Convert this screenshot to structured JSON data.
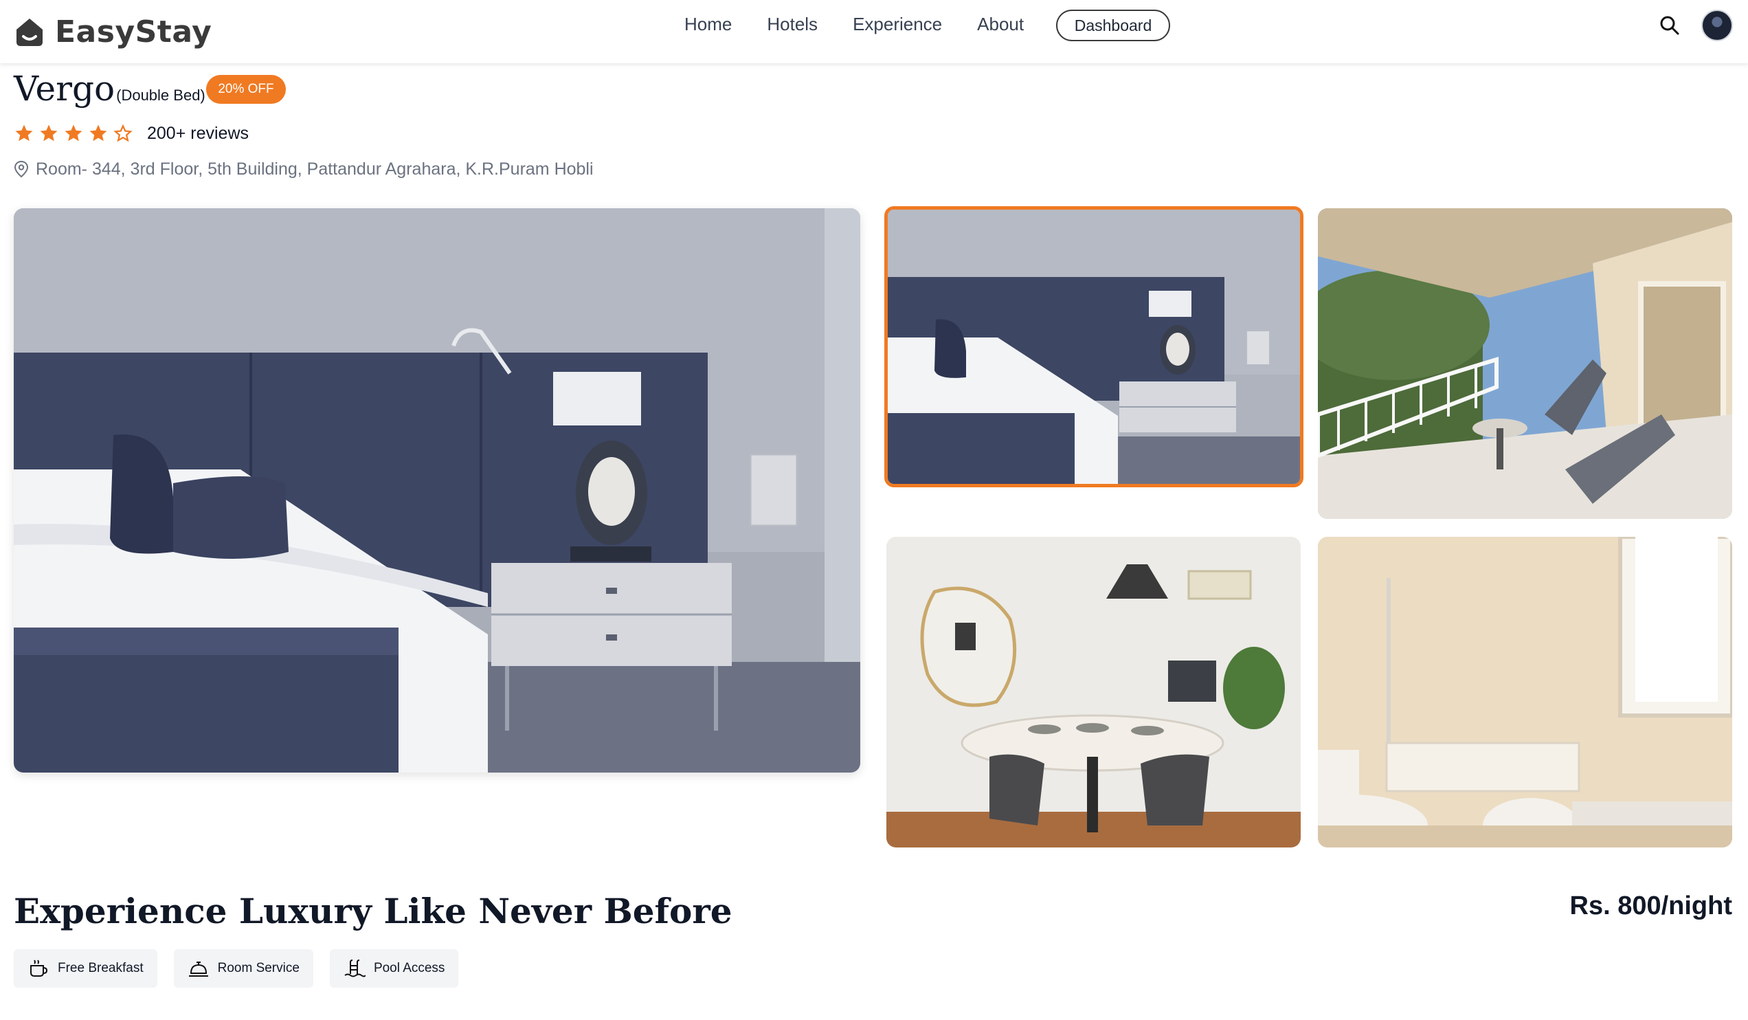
{
  "brand": {
    "name": "EasyStay",
    "icon": "house-logo-icon"
  },
  "nav": {
    "links": [
      "Home",
      "Hotels",
      "Experience",
      "About"
    ],
    "dashboard": "Dashboard",
    "search_icon": "search-icon",
    "avatar": "user-avatar"
  },
  "room": {
    "name": "Vergo",
    "bed_type": "(Double Bed)",
    "discount": "20% OFF",
    "rating": 4,
    "rating_max": 5,
    "reviews": "200+ reviews",
    "address": "Room- 344, 3rd Floor, 5th Building, Pattandur Agrahara, K.R.Puram Hobli"
  },
  "gallery": {
    "photos": [
      "bedroom-main",
      "bedroom-thumb",
      "balcony",
      "dining-room",
      "bathroom"
    ],
    "selected_index": 0
  },
  "details": {
    "tagline": "Experience Luxury Like Never Before",
    "price": "Rs. 800/night",
    "amenities": [
      {
        "label": "Free Breakfast",
        "icon": "coffee-cup-icon"
      },
      {
        "label": "Room Service",
        "icon": "service-bell-icon"
      },
      {
        "label": "Pool Access",
        "icon": "pool-ladder-icon"
      }
    ]
  },
  "colors": {
    "accent": "#f07a22",
    "text": "#111827",
    "muted": "#6b7280",
    "chip_bg": "#f3f4f6"
  }
}
